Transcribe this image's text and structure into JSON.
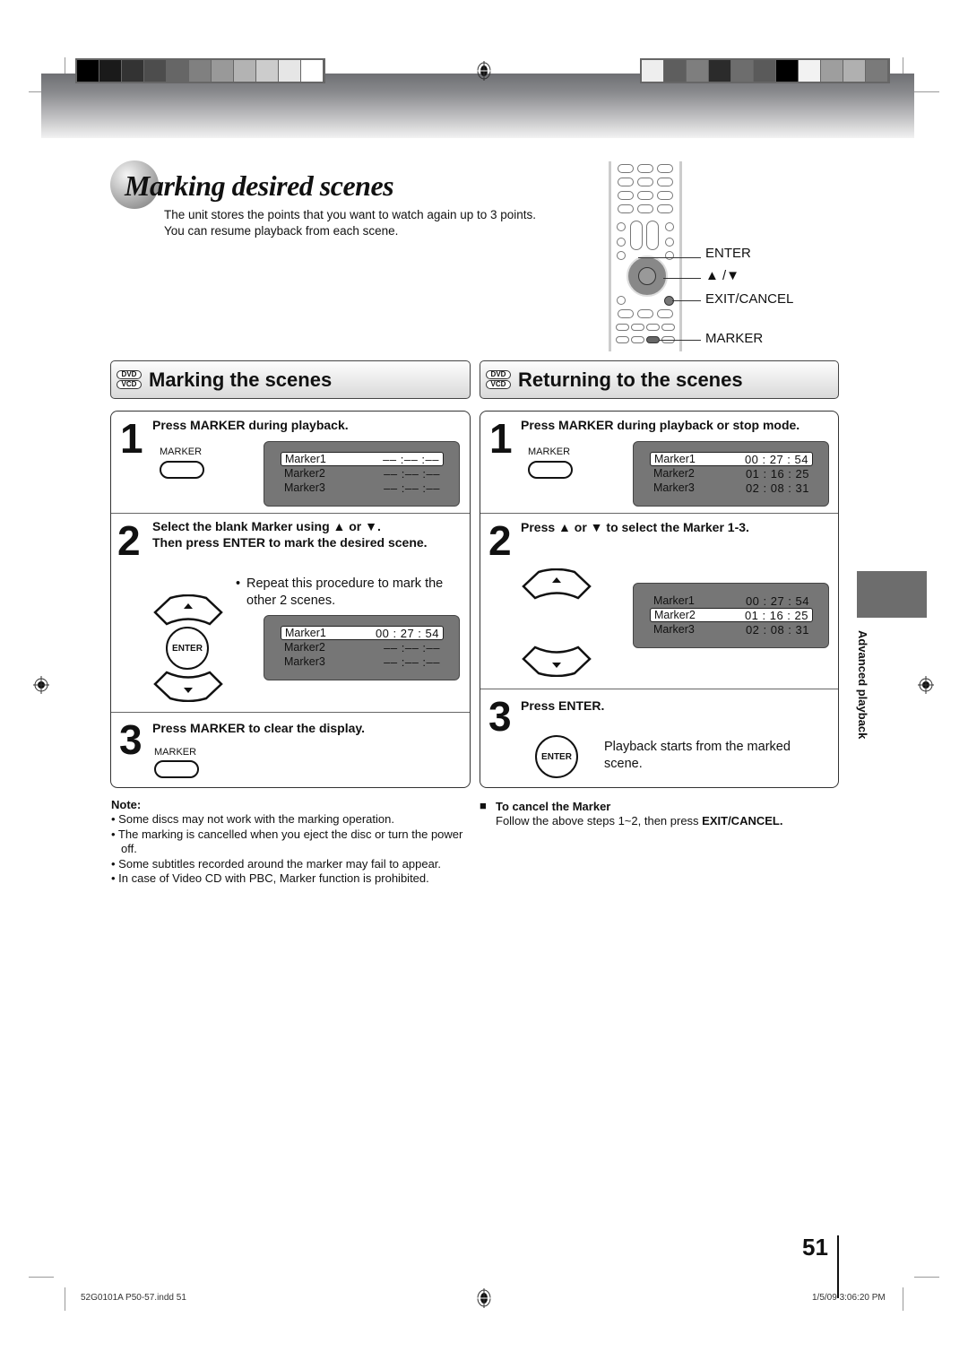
{
  "header": {
    "left_swatches": [
      "#000000",
      "#1a1a1a",
      "#333333",
      "#4d4d4d",
      "#666666",
      "#808080",
      "#999999",
      "#b3b3b3",
      "#cccccc",
      "#e6e6e6",
      "#ffffff"
    ],
    "right_swatches": [
      "#eeeeee",
      "#5e5e5e",
      "#7e7e7e",
      "#2b2b2b",
      "#6d6d6d",
      "#5a5a5a",
      "#000000",
      "#f2f2f2",
      "#9e9e9e",
      "#b0b0b0",
      "#7a7a7a"
    ]
  },
  "title": {
    "text": "Marking desired scenes",
    "intro_line1": "The unit stores the points that you want to watch again up to 3 points.",
    "intro_line2": "You can resume playback from each scene."
  },
  "remote": {
    "labels": {
      "enter": "ENTER",
      "updown": "▲ /▼",
      "exit_cancel": "EXIT/CANCEL",
      "marker": "MARKER"
    }
  },
  "marking": {
    "header": "Marking the scenes",
    "badges": [
      "DVD",
      "VCD"
    ],
    "step1": {
      "num": "1",
      "text": "Press MARKER during playback.",
      "button_label": "MARKER",
      "osd": [
        {
          "name": "Marker1",
          "time": "–– :–– :––",
          "selected": true
        },
        {
          "name": "Marker2",
          "time": "–– :–– :––",
          "selected": false
        },
        {
          "name": "Marker3",
          "time": "–– :–– :––",
          "selected": false
        }
      ]
    },
    "step2": {
      "num": "2",
      "text_line1": "Select the blank Marker using  ▲ or ▼.",
      "text_line2": "Then press ENTER to mark the desired scene.",
      "bullet_line1": "Repeat this procedure to mark the",
      "bullet_line2": "other 2 scenes.",
      "enter_label": "ENTER",
      "osd": [
        {
          "name": "Marker1",
          "time": "00 : 27 : 54",
          "selected": true
        },
        {
          "name": "Marker2",
          "time": "–– :–– :––",
          "selected": false
        },
        {
          "name": "Marker3",
          "time": "–– :–– :––",
          "selected": false
        }
      ]
    },
    "step3": {
      "num": "3",
      "text": "Press MARKER to clear the display.",
      "button_label": "MARKER"
    },
    "note": {
      "title": "Note:",
      "items": [
        "• Some discs may not work with the marking operation.",
        "• The marking is cancelled when you eject the disc or turn the power off.",
        "• Some subtitles recorded around the marker may fail to appear.",
        "• In case of Video CD with PBC, Marker function is prohibited."
      ]
    }
  },
  "returning": {
    "header": "Returning to the scenes",
    "badges": [
      "DVD",
      "VCD"
    ],
    "step1": {
      "num": "1",
      "text": "Press MARKER during playback or stop mode.",
      "button_label": "MARKER",
      "osd": [
        {
          "name": "Marker1",
          "time": "00 : 27 : 54",
          "selected": true
        },
        {
          "name": "Marker2",
          "time": "01 : 16 : 25",
          "selected": false
        },
        {
          "name": "Marker3",
          "time": "02 : 08 : 31",
          "selected": false
        }
      ]
    },
    "step2": {
      "num": "2",
      "text": "Press ▲ or ▼ to select the Marker 1-3.",
      "osd": [
        {
          "name": "Marker1",
          "time": "00 : 27 : 54",
          "selected": false
        },
        {
          "name": "Marker2",
          "time": "01 : 16 : 25",
          "selected": true
        },
        {
          "name": "Marker3",
          "time": "02 : 08 : 31",
          "selected": false
        }
      ]
    },
    "step3": {
      "num": "3",
      "text": "Press ENTER.",
      "enter_label": "ENTER",
      "desc_line1": "Playback starts from the marked",
      "desc_line2": "scene."
    },
    "cancel": {
      "bullet": "■",
      "title": "To cancel the Marker",
      "text_prefix": "Follow the above steps 1~2, then press ",
      "text_bold": "EXIT/CANCEL."
    }
  },
  "side_tab": {
    "label": "Advanced playback"
  },
  "footer": {
    "page_number": "51",
    "file_info": "52G0101A P50-57.indd   51",
    "timestamp": "1/5/09   3:06:20 PM"
  }
}
